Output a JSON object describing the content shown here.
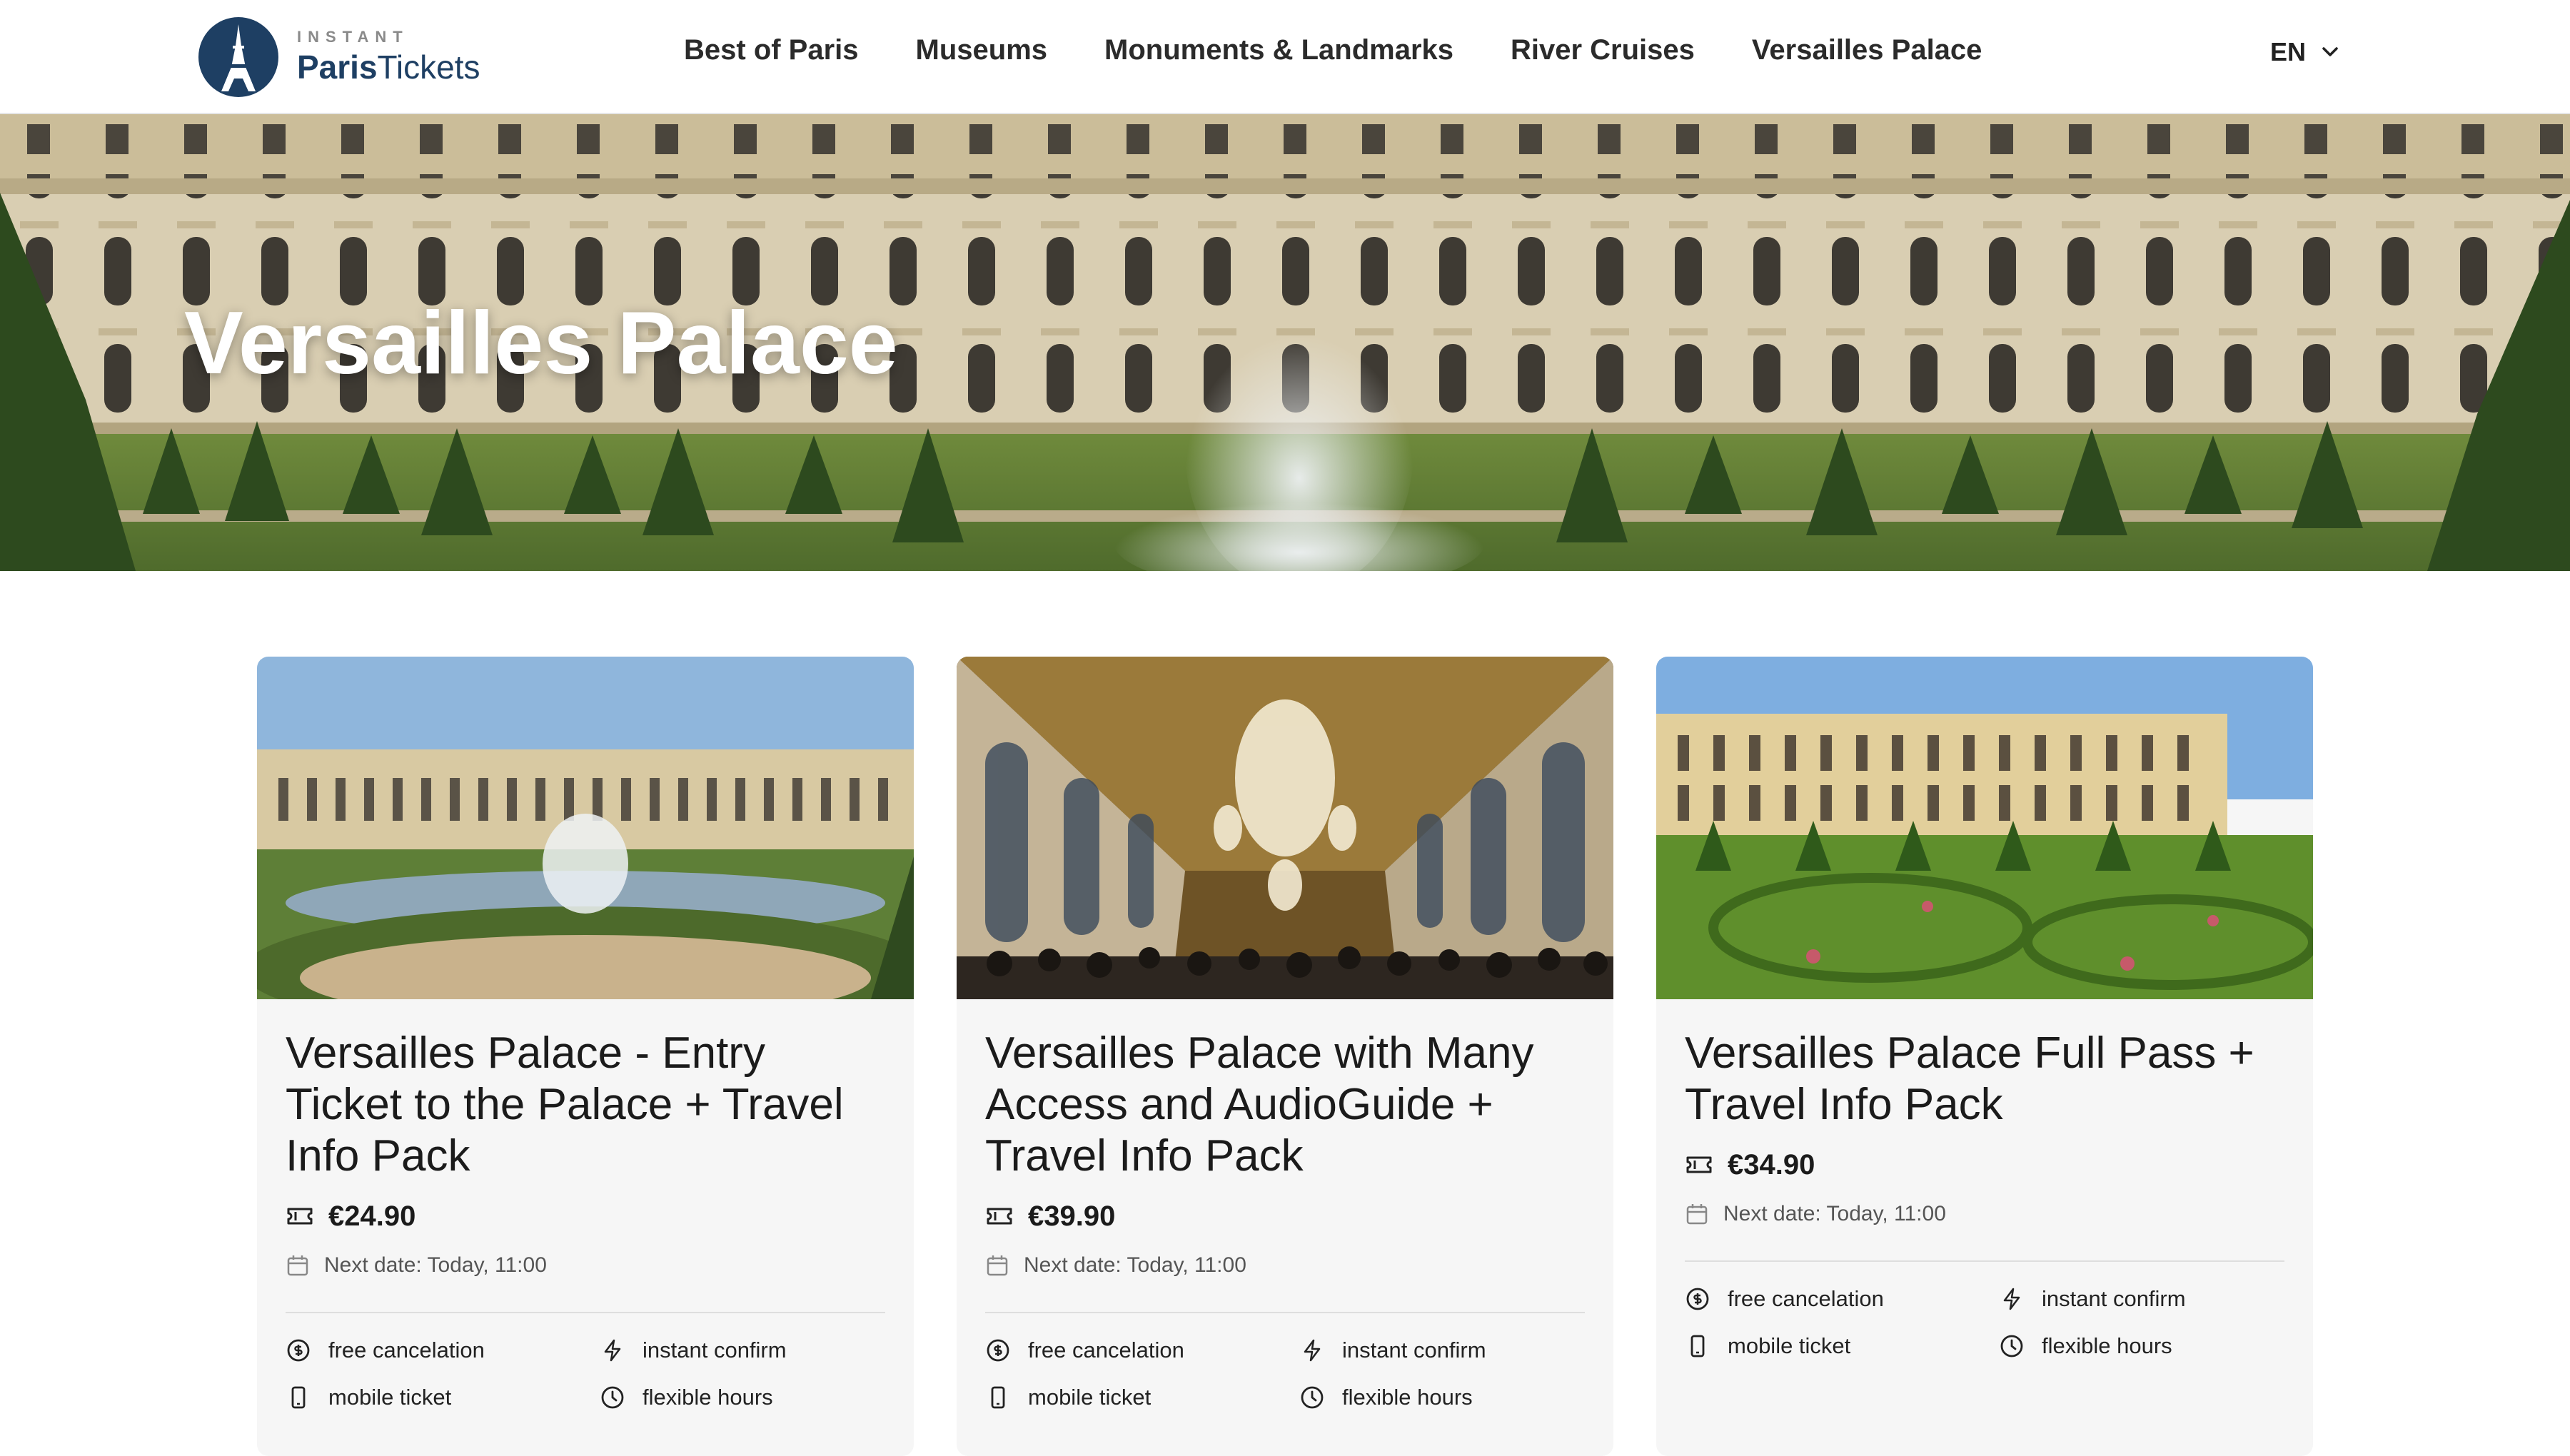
{
  "header": {
    "logo_small": "INSTANT",
    "logo_bold": "Paris",
    "logo_light": "Tickets",
    "nav": [
      {
        "label": "Best of Paris"
      },
      {
        "label": "Museums"
      },
      {
        "label": "Monuments & Landmarks"
      },
      {
        "label": "River Cruises"
      },
      {
        "label": "Versailles Palace"
      }
    ],
    "language": "EN"
  },
  "hero": {
    "title": "Versailles Palace"
  },
  "cards": [
    {
      "title": "Versailles Palace - Entry Ticket to the Palace + Travel Info Pack",
      "price": "€24.90",
      "next_date": "Next date: Today, 11:00",
      "features": [
        "free cancelation",
        "instant confirm",
        "mobile ticket",
        "flexible hours"
      ]
    },
    {
      "title": "Versailles Palace with Many Access and AudioGuide + Travel Info Pack",
      "price": "€39.90",
      "next_date": "Next date: Today, 11:00",
      "features": [
        "free cancelation",
        "instant confirm",
        "mobile ticket",
        "flexible hours"
      ]
    },
    {
      "title": "Versailles Palace Full Pass + Travel Info Pack",
      "price": "€34.90",
      "next_date": "Next date: Today, 11:00",
      "features": [
        "free cancelation",
        "instant confirm",
        "mobile ticket",
        "flexible hours"
      ]
    }
  ],
  "colors": {
    "brand": "#1e3f63",
    "card_bg": "#f6f6f6",
    "text": "#1f1f1f"
  },
  "icons": [
    "eiffel-tower-icon",
    "chevron-down-icon",
    "ticket-icon",
    "calendar-icon",
    "dollar-circle-icon",
    "lightning-icon",
    "phone-icon",
    "clock-icon"
  ]
}
